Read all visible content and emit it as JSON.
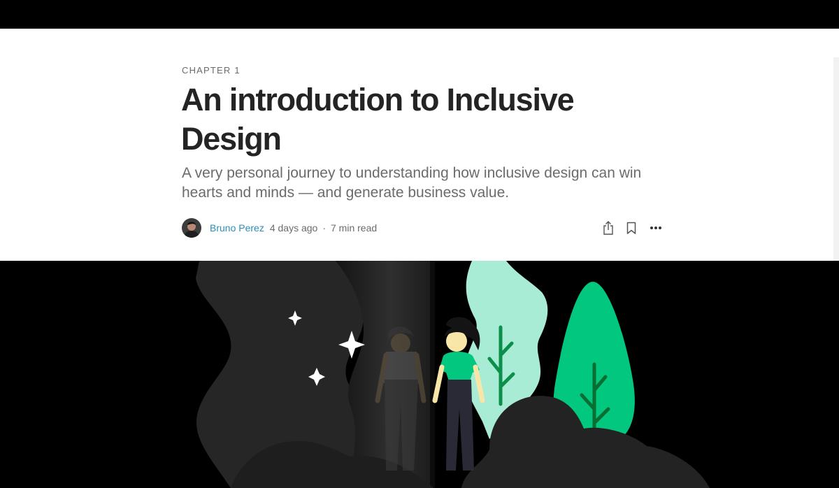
{
  "article": {
    "kicker": "CHAPTER 1",
    "title": "An introduction to Inclusive Design",
    "subtitle": "A very personal journey to understanding how inclusive design can win hearts and minds — and generate business value.",
    "author": "Bruno Perez",
    "published": "4 days ago",
    "separator": "·",
    "read_time": "7 min read"
  },
  "icons": {
    "share": "share-icon",
    "bookmark": "bookmark-icon",
    "more": "more-icon"
  },
  "colors": {
    "author_link": "#2a8fb5",
    "title": "#242424",
    "muted": "#6b6b6b",
    "hero_green": "#02c77f",
    "hero_mint": "#a8ecd6"
  }
}
